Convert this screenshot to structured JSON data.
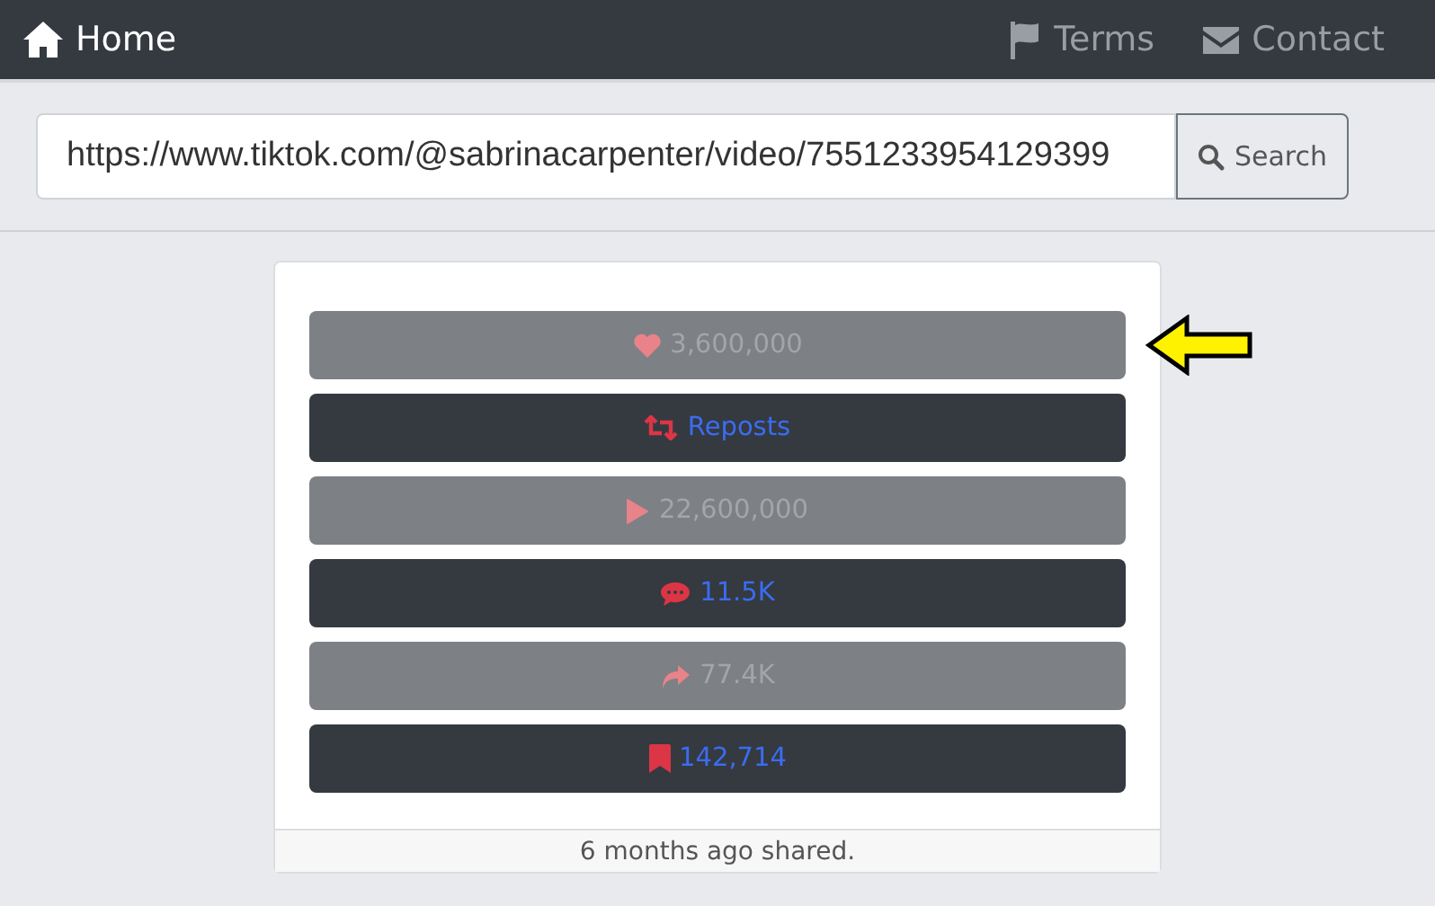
{
  "navbar": {
    "brand": "Home",
    "links": [
      {
        "label": "Terms"
      },
      {
        "label": "Contact"
      }
    ]
  },
  "search": {
    "value": "https://www.tiktok.com/@sabrinacarpenter/video/7551233954129399",
    "button": "Search"
  },
  "stats": [
    {
      "kind": "likes",
      "label": "3,600,000",
      "disabled": true,
      "pointed": true
    },
    {
      "kind": "reposts",
      "label": "Reposts",
      "disabled": false,
      "pointed": false
    },
    {
      "kind": "plays",
      "label": "22,600,000",
      "disabled": true,
      "pointed": false
    },
    {
      "kind": "comments",
      "label": "11.5K",
      "disabled": false,
      "pointed": false
    },
    {
      "kind": "shares",
      "label": "77.4K",
      "disabled": true,
      "pointed": false
    },
    {
      "kind": "saves",
      "label": "142,714",
      "disabled": false,
      "pointed": false
    }
  ],
  "footer": "6 months ago shared."
}
